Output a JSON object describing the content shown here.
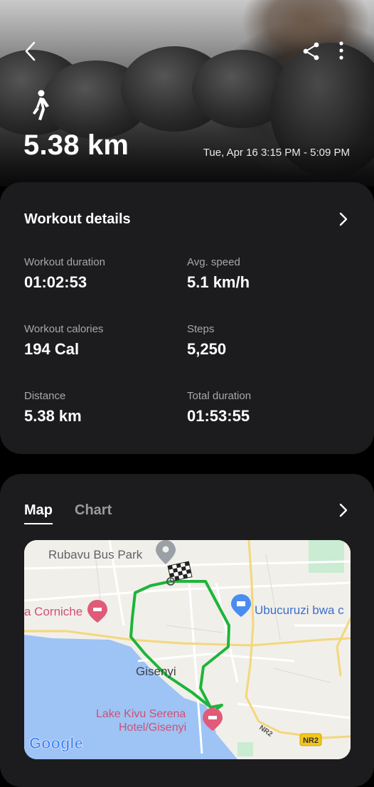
{
  "header": {
    "distance": "5.38 km",
    "date_range": "Tue, Apr 16 3:15 PM - 5:09 PM",
    "activity_icon": "walking-icon"
  },
  "workout_details": {
    "title": "Workout details",
    "stats": [
      {
        "label": "Workout duration",
        "value": "01:02:53"
      },
      {
        "label": "Avg. speed",
        "value": "5.1 km/h"
      },
      {
        "label": "Workout calories",
        "value": "194 Cal"
      },
      {
        "label": "Steps",
        "value": "5,250"
      },
      {
        "label": "Distance",
        "value": "5.38 km"
      },
      {
        "label": "Total duration",
        "value": "01:53:55"
      }
    ]
  },
  "map_section": {
    "tabs": [
      {
        "label": "Map",
        "active": true
      },
      {
        "label": "Chart",
        "active": false
      }
    ],
    "places": {
      "bus_park": "Rubavu Bus Park",
      "corniche": "a Corniche",
      "ubucuruzi": "Ubucuruzi bwa c",
      "gisenyi": "Gisenyi",
      "serena_line1": "Lake Kivu Serena",
      "serena_line2": "Hotel/Gisenyi",
      "road_nr2": "NR2",
      "road_nr2_rotated": "NR2"
    },
    "logo": "Google"
  },
  "colors": {
    "card_bg": "#1c1c1e",
    "route": "#1db53a",
    "lake": "#9ec3f5",
    "pin_red": "#e05a7a",
    "pin_blue": "#4a8df0"
  }
}
